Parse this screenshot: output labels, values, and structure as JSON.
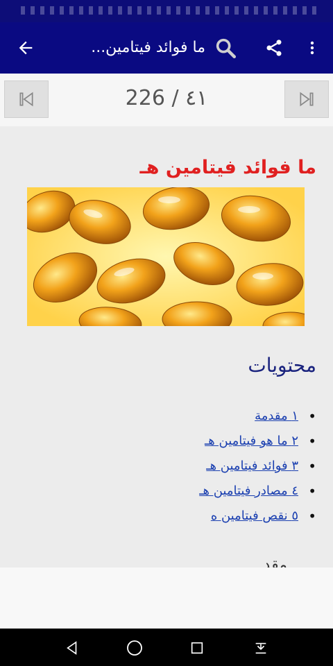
{
  "app_bar": {
    "title": "ما فوائد فيتامين...",
    "icons": [
      "back-arrow-icon",
      "search-icon",
      "share-icon",
      "more-vert-icon"
    ]
  },
  "pager": {
    "counter": "226 / ٤١",
    "icons": [
      "skip-first-icon",
      "skip-last-icon"
    ]
  },
  "article": {
    "title": "ما فوائد فيتامين هـ",
    "contents_heading": "محتويات",
    "toc": [
      {
        "label": "١ مقدمة"
      },
      {
        "label": "٢ ما هو فيتامين هـ"
      },
      {
        "label": "٣ فوائد فيتامين هـ"
      },
      {
        "label": "٤ مصادر فيتامين هـ"
      },
      {
        "label": "٥ نقص فيتامين ه"
      }
    ],
    "next_section_partial": "مقدمة"
  },
  "system_nav": {
    "icons": [
      "back-triangle-icon",
      "home-circle-icon",
      "recents-square-icon",
      "notification-pull-icon"
    ]
  },
  "colors": {
    "app_bar": "#0a0a82",
    "heading": "#e02020",
    "link": "#1a3fb0",
    "subheading": "#1a237e"
  }
}
